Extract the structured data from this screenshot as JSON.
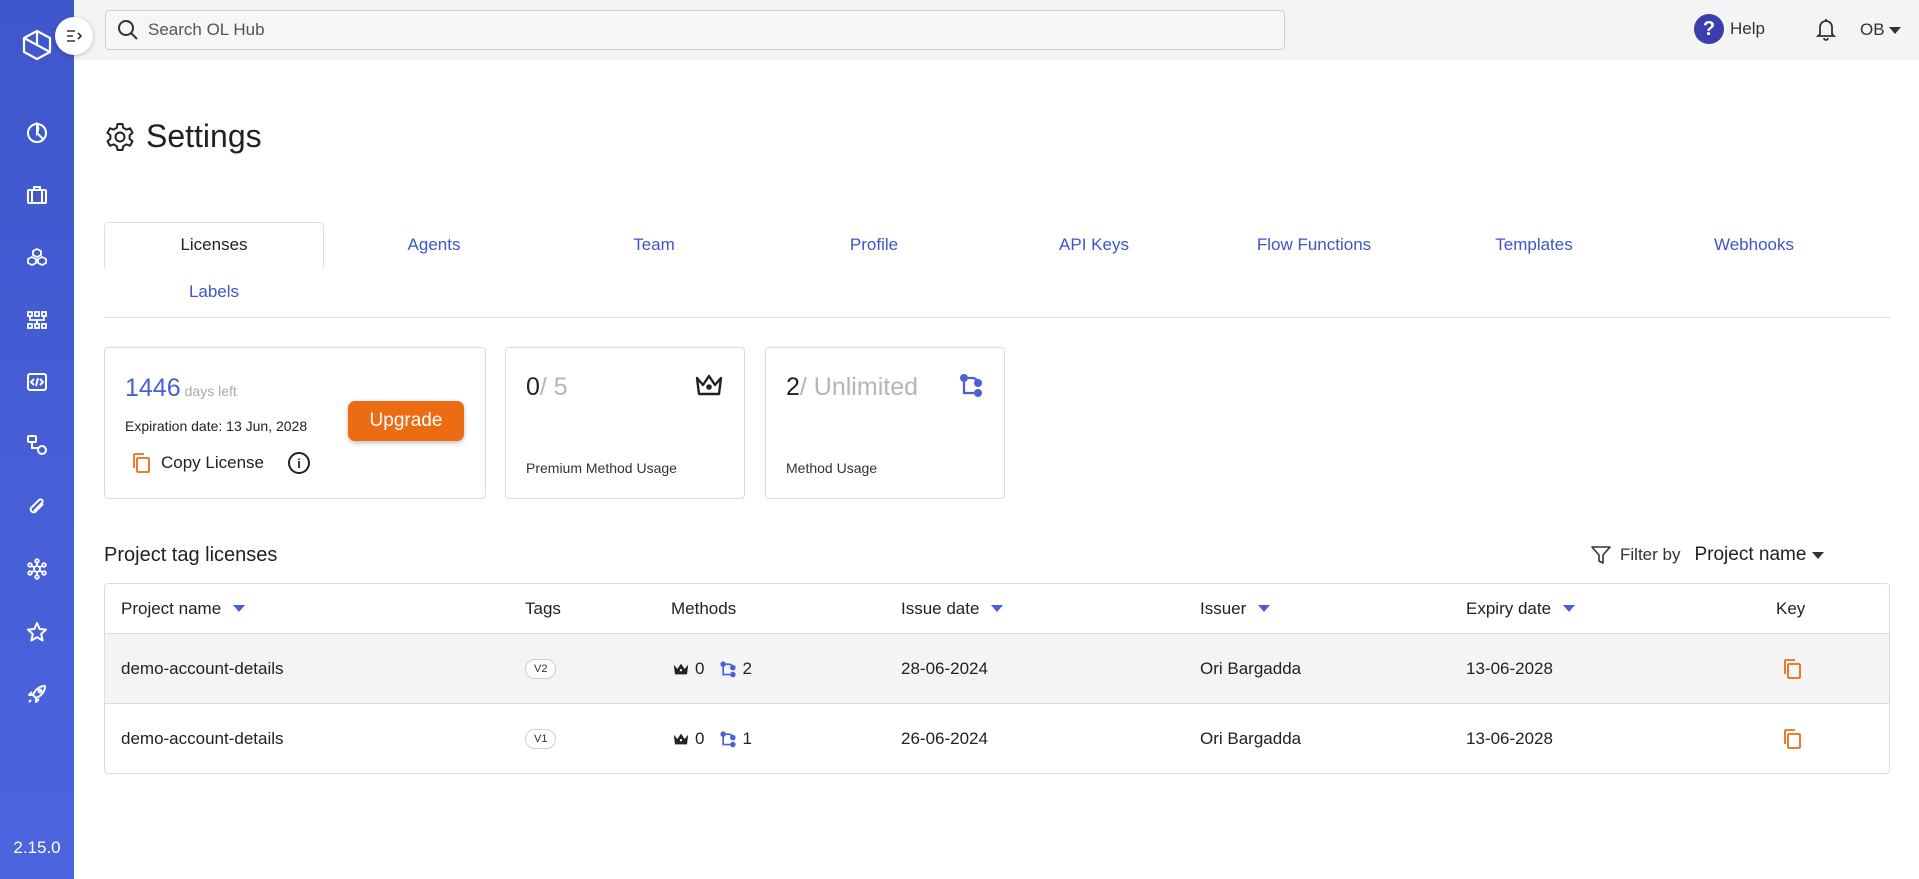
{
  "sidebar": {
    "version": "2.15.0",
    "items": [
      "analytics-icon",
      "briefcase-icon",
      "cubes-icon",
      "hierarchy-icon",
      "code-icon",
      "flow-icon",
      "paperclip-icon",
      "network-icon",
      "star-icon",
      "rocket-icon"
    ],
    "accent": "#4a62dc"
  },
  "topbar": {
    "search_placeholder": "Search OL Hub",
    "help_label": "Help",
    "help_glyph": "?",
    "user_initials": "OB"
  },
  "page": {
    "title": "Settings"
  },
  "tabs": [
    {
      "label": "Licenses",
      "active": true
    },
    {
      "label": "Agents"
    },
    {
      "label": "Team"
    },
    {
      "label": "Profile"
    },
    {
      "label": "API Keys"
    },
    {
      "label": "Flow Functions"
    },
    {
      "label": "Templates"
    },
    {
      "label": "Webhooks"
    },
    {
      "label": "Labels"
    }
  ],
  "license_card": {
    "days": "1446",
    "days_label": "days left",
    "expiration": "Expiration date: 13 Jun, 2028",
    "copy_label": "Copy License",
    "info_glyph": "i",
    "upgrade_label": "Upgrade"
  },
  "premium_card": {
    "used": "0",
    "max": "/ 5",
    "label": "Premium Method Usage"
  },
  "method_card": {
    "used": "2",
    "max": "/ Unlimited",
    "label": "Method Usage"
  },
  "section": {
    "title": "Project tag licenses",
    "filter_label": "Filter by",
    "filter_value": "Project name"
  },
  "table": {
    "headers": {
      "project": "Project name",
      "tags": "Tags",
      "methods": "Methods",
      "issue": "Issue date",
      "issuer": "Issuer",
      "expiry": "Expiry date",
      "key": "Key"
    },
    "rows": [
      {
        "project": "demo-account-details",
        "tag": "V2",
        "premium": "0",
        "methods": "2",
        "issue": "28-06-2024",
        "issuer": "Ori Bargadda",
        "expiry": "13-06-2028"
      },
      {
        "project": "demo-account-details",
        "tag": "V1",
        "premium": "0",
        "methods": "1",
        "issue": "26-06-2024",
        "issuer": "Ori Bargadda",
        "expiry": "13-06-2028"
      }
    ]
  },
  "colors": {
    "primary": "#3f55c6",
    "orange": "#ec6c13"
  }
}
